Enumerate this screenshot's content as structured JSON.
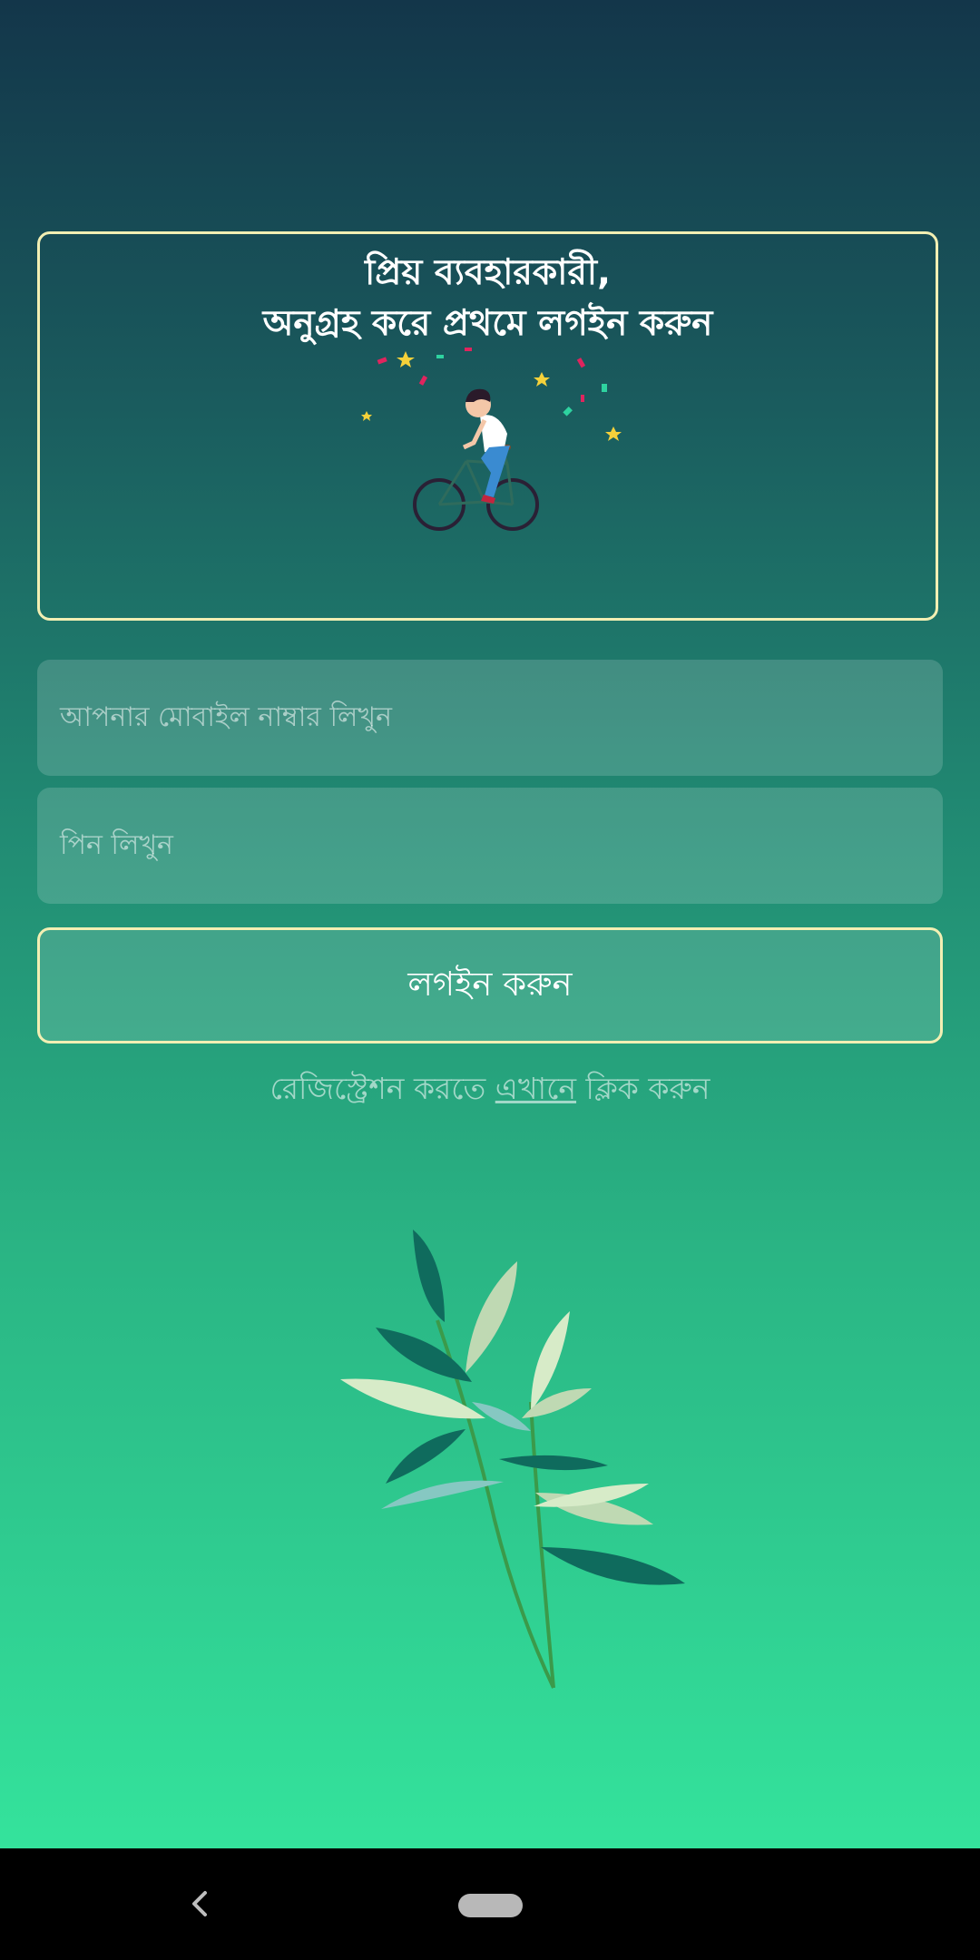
{
  "welcome": {
    "line1": "প্রিয় ব্যবহারকারী,",
    "line2": "অনুগ্রহ করে প্রথমে লগইন করুন"
  },
  "form": {
    "phone_placeholder": "আপনার মোবাইল নাম্বার লিখুন",
    "pin_placeholder": "পিন লিখুন",
    "login_label": "লগইন করুন"
  },
  "register": {
    "prefix": "রেজিস্ট্রেশন করতে ",
    "link": "এখানে",
    "suffix": " ক্লিক করুন"
  },
  "icons": {
    "back": "chevron-left-icon",
    "home": "home-pill-icon"
  },
  "colors": {
    "accent_border": "#f2efb3",
    "gradient_top": "#13364a",
    "gradient_bottom": "#34e39c"
  }
}
